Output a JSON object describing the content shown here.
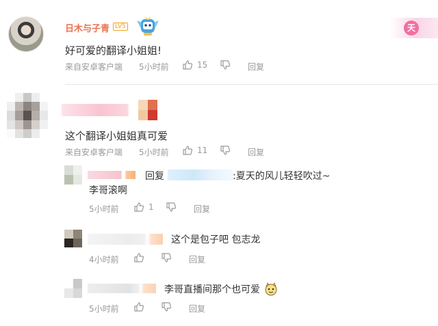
{
  "colors": {
    "username": "#eb7350",
    "meta": "#999999",
    "text": "#333333",
    "accent_pink": "#f06fa2"
  },
  "top_comment": {
    "username": "日木与子青",
    "level_badge": "LV5",
    "deco_glyph": "天",
    "text": "好可爱的翻译小姐姐!",
    "source": "来自安卓客户端",
    "time": "5小时前",
    "like_count": "15",
    "reply_label": "回复"
  },
  "second_comment": {
    "text": "这个翻译小姐姐真可爱",
    "source": "来自安卓客户端",
    "time": "5小时前",
    "like_count": "11",
    "reply_label": "回复"
  },
  "replies": [
    {
      "reply_prefix": "回复",
      "reply_target_suffix": ":夏天的风儿轻轻吹过~",
      "text": "李哥滚啊",
      "time": "5小时前",
      "like_count": "1",
      "reply_label": "回复"
    },
    {
      "text": "这个是包子吧 包志龙",
      "time": "4小时前",
      "like_count": "",
      "reply_label": "回复"
    },
    {
      "text": "李哥直播间那个也可爱",
      "time": "5小时前",
      "like_count": "",
      "reply_label": "回复"
    }
  ],
  "icons": [
    "thumbs-up-icon",
    "thumbs-down-icon",
    "vip-mascot-icon",
    "smile-emoji-icon"
  ]
}
